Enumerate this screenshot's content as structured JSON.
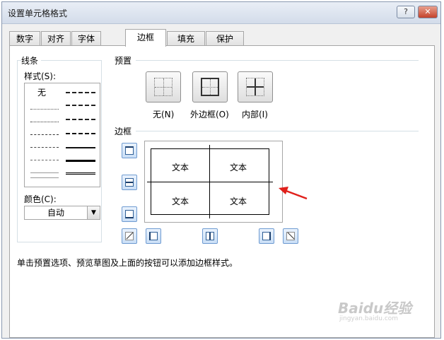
{
  "window": {
    "title": "设置单元格格式",
    "help_label": "?",
    "close_label": "✕"
  },
  "tabs": [
    {
      "label": "数字",
      "active": false
    },
    {
      "label": "对齐",
      "active": false
    },
    {
      "label": "字体",
      "active": false
    },
    {
      "label": "边框",
      "active": true
    },
    {
      "label": "填充",
      "active": false
    },
    {
      "label": "保护",
      "active": false
    }
  ],
  "line": {
    "group_title": "线条",
    "style_label": "样式(S):",
    "none_label": "无",
    "color_label": "颜色(C):",
    "color_value": "自动"
  },
  "presets": {
    "group_title": "预置",
    "items": [
      {
        "label": "无(N)",
        "icon": "preset-none-icon"
      },
      {
        "label": "外边框(O)",
        "icon": "preset-outline-icon"
      },
      {
        "label": "内部(I)",
        "icon": "preset-inside-icon"
      }
    ]
  },
  "border": {
    "group_title": "边框",
    "preview_cells": [
      "文本",
      "文本",
      "文本",
      "文本"
    ]
  },
  "hint_text": "单击预置选项、预览草图及上面的按钮可以添加边框样式。",
  "annotation": {
    "arrow_color": "#e0201b"
  },
  "watermark": {
    "text": "Baidu经验",
    "url": "jingyan.baidu.com"
  }
}
